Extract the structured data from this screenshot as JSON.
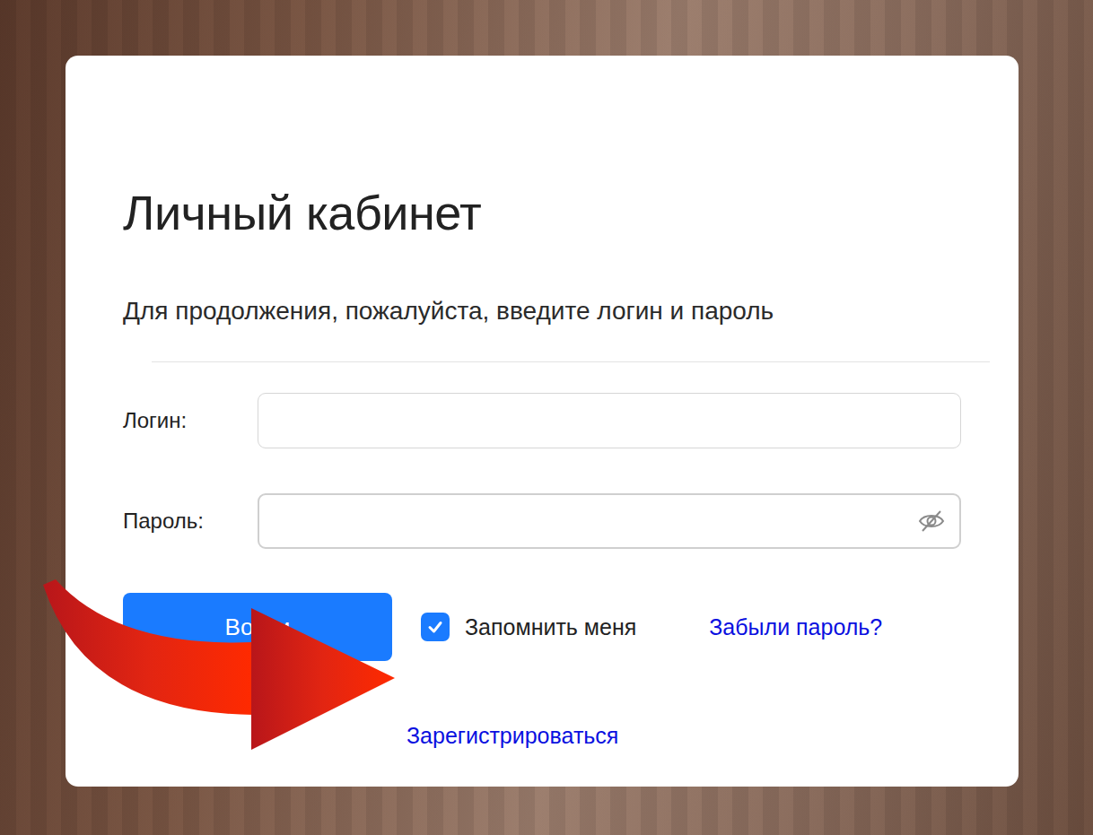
{
  "window": {
    "title": "Личный кабинет"
  },
  "subtitle": "Для продолжения, пожалуйста, введите логин и пароль",
  "fields": [
    {
      "label": "Логин:",
      "value": "",
      "kind": "text"
    },
    {
      "label": "Пароль:",
      "value": "",
      "kind": "password"
    }
  ],
  "login_button": "Войти",
  "remember": {
    "label": "Запомнить меня",
    "checked": true
  },
  "forgot_link": "Забыли пароль?",
  "register_link": "Зарегистрироваться"
}
